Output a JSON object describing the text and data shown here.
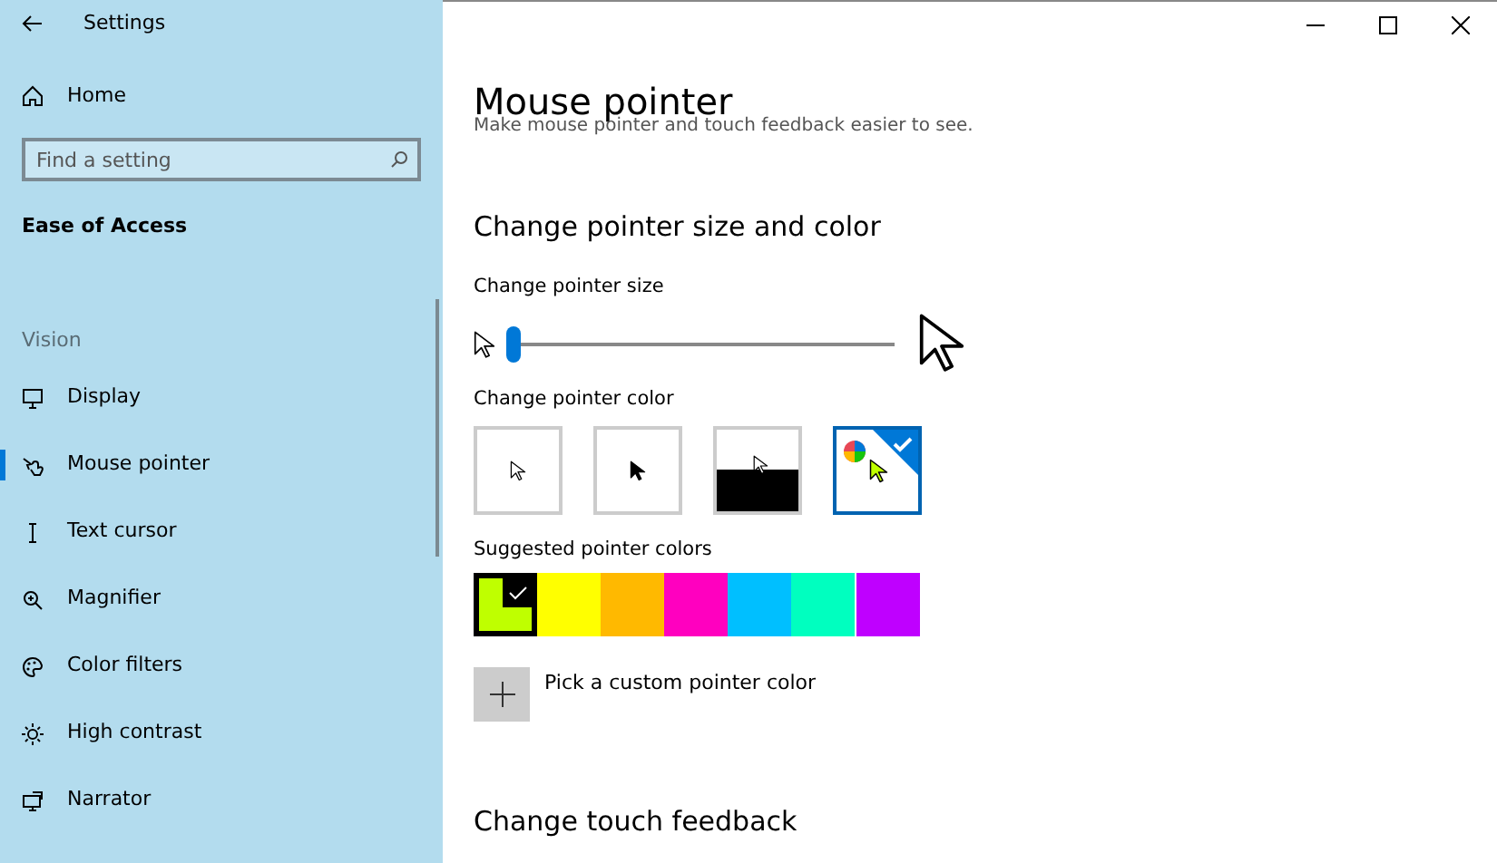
{
  "window": {
    "title": "Settings"
  },
  "sidebar": {
    "home": "Home",
    "search": {
      "placeholder": "Find a setting"
    },
    "section": "Ease of Access",
    "group": "Vision",
    "items": [
      {
        "label": "Display",
        "kind": "display",
        "selected": false
      },
      {
        "label": "Mouse pointer",
        "kind": "mouse",
        "selected": true
      },
      {
        "label": "Text cursor",
        "kind": "cursor",
        "selected": false
      },
      {
        "label": "Magnifier",
        "kind": "magnifier",
        "selected": false
      },
      {
        "label": "Color filters",
        "kind": "palette",
        "selected": false
      },
      {
        "label": "High contrast",
        "kind": "sun",
        "selected": false
      },
      {
        "label": "Narrator",
        "kind": "narrator",
        "selected": false
      }
    ]
  },
  "main": {
    "title": "Mouse pointer",
    "subtitle": "Make mouse pointer and touch feedback easier to see.",
    "heading": "Change pointer size and color",
    "size_label": "Change pointer size",
    "size_slider": {
      "level": 0.0
    },
    "color_label": "Change pointer color",
    "color_options": [
      {
        "kind": "white",
        "selected": false
      },
      {
        "kind": "black",
        "selected": false
      },
      {
        "kind": "inverted",
        "selected": false
      },
      {
        "kind": "custom",
        "selected": true
      }
    ],
    "suggested_label": "Suggested pointer colors",
    "swatches": [
      {
        "color": "#bfff00",
        "selected": true
      },
      {
        "color": "#ffff00",
        "selected": false
      },
      {
        "color": "#ffb900",
        "selected": false
      },
      {
        "color": "#ff00bf",
        "selected": false
      },
      {
        "color": "#00bfff",
        "selected": false
      },
      {
        "color": "#00ffbf",
        "selected": false
      },
      {
        "color": "#bf00ff",
        "selected": false
      }
    ],
    "custom_label": "Pick a custom pointer color",
    "touch_heading": "Change touch feedback"
  }
}
